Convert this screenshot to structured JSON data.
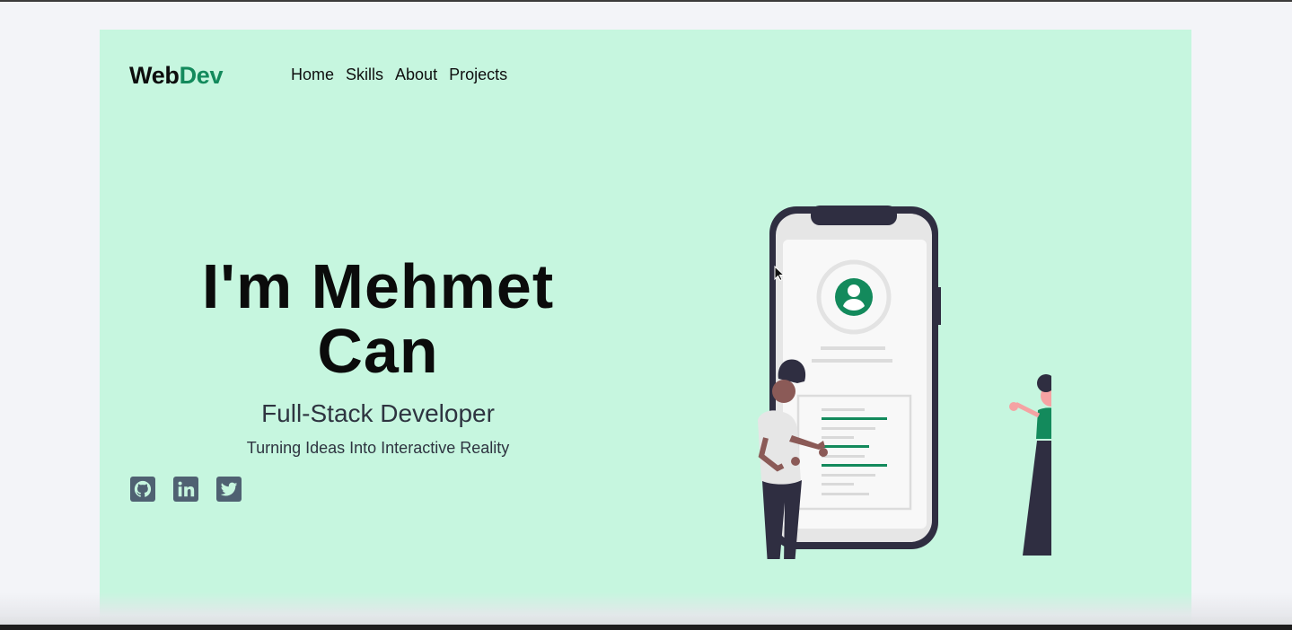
{
  "brand": {
    "logo_main": "Web",
    "logo_accent": "Dev"
  },
  "nav": {
    "items": [
      "Home",
      "Skills",
      "About",
      "Projects"
    ]
  },
  "hero": {
    "title_line1": "I'm Mehmet",
    "title_line2": "Can",
    "role": "Full-Stack Developer",
    "tagline": "Turning Ideas Into Interactive Reality"
  },
  "socials": [
    "github-icon",
    "linkedin-icon",
    "twitter-icon"
  ],
  "colors": {
    "hero_bg": "#c6f6df",
    "accent": "#138a5c",
    "icon_bg": "#4f6172",
    "dark": "#2f2e41"
  }
}
